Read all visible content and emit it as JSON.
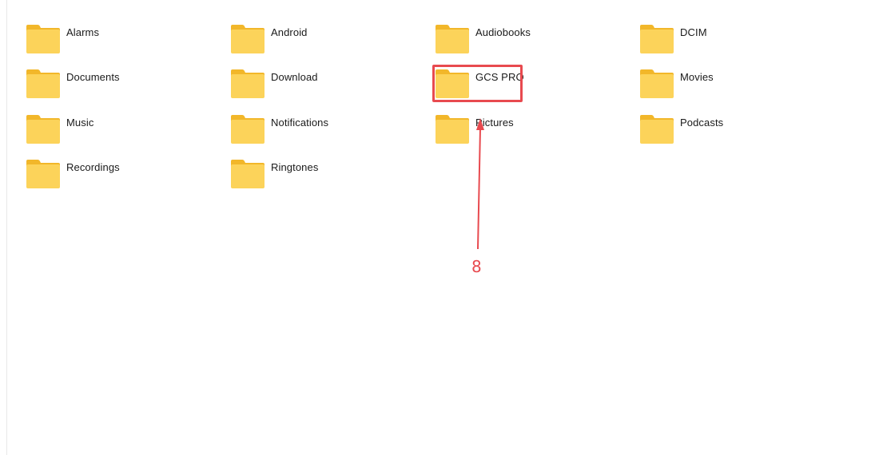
{
  "folders": [
    {
      "name": "Alarms",
      "icon": "folder-icon"
    },
    {
      "name": "Android",
      "icon": "folder-icon"
    },
    {
      "name": "Audiobooks",
      "icon": "folder-icon"
    },
    {
      "name": "DCIM",
      "icon": "folder-icon"
    },
    {
      "name": "Documents",
      "icon": "folder-icon"
    },
    {
      "name": "Download",
      "icon": "folder-icon"
    },
    {
      "name": "GCS PRO",
      "icon": "folder-icon"
    },
    {
      "name": "Movies",
      "icon": "folder-icon"
    },
    {
      "name": "Music",
      "icon": "folder-icon"
    },
    {
      "name": "Notifications",
      "icon": "folder-icon"
    },
    {
      "name": "Pictures",
      "icon": "folder-icon"
    },
    {
      "name": "Podcasts",
      "icon": "folder-icon"
    },
    {
      "name": "Recordings",
      "icon": "folder-icon"
    },
    {
      "name": "Ringtones",
      "icon": "folder-icon"
    }
  ],
  "annotation": {
    "step": "8",
    "target": "GCS PRO",
    "color": "#e84a4f"
  },
  "colors": {
    "folder_front": "#fcd35a",
    "folder_back": "#f2b72a",
    "label_text": "#1a1a1a"
  }
}
